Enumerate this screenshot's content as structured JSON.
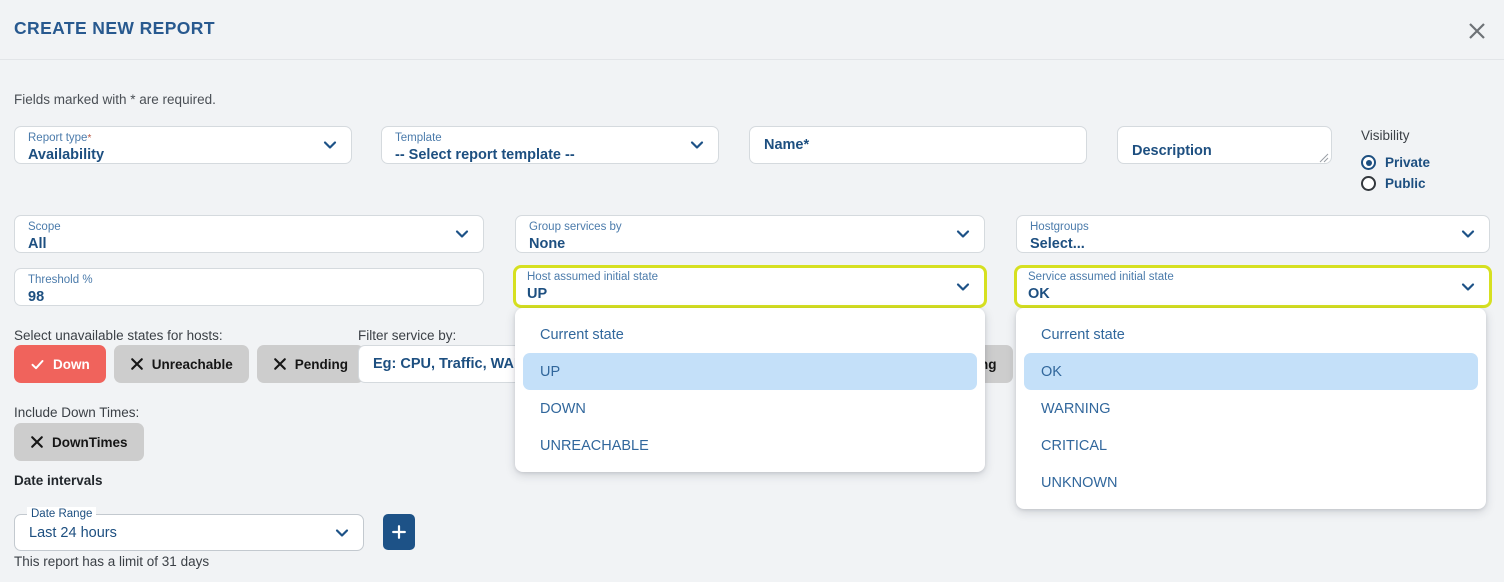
{
  "header": {
    "title": "CREATE NEW REPORT",
    "close_icon": "close-icon"
  },
  "notes": {
    "required": "Fields marked with * are required.",
    "limit": "This report has a limit of 31 days"
  },
  "colors": {
    "accent_navy": "#1d5287",
    "highlight_yellow": "#d6e021",
    "chip_active_red": "#f0635c",
    "chip_inactive_gray": "#cdcdcd",
    "menu_selected_blue": "#c4e0f9"
  },
  "fields": {
    "report_type": {
      "label": "Report type",
      "required_mark": "*",
      "value": "Availability",
      "icon": "chevron-down-icon"
    },
    "template": {
      "label": "Template",
      "value": "-- Select report template --",
      "icon": "chevron-down-icon"
    },
    "name": {
      "placeholder": "Name*",
      "value": ""
    },
    "description": {
      "placeholder": "Description",
      "value": ""
    },
    "scope": {
      "label": "Scope",
      "value": "All",
      "icon": "chevron-down-icon"
    },
    "group_services_by": {
      "label": "Group services by",
      "value": "None",
      "icon": "chevron-down-icon"
    },
    "hostgroups": {
      "label": "Hostgroups",
      "value": "Select...",
      "icon": "chevron-down-icon"
    },
    "threshold": {
      "label": "Threshold %",
      "value": "98"
    },
    "host_initial_state": {
      "label": "Host assumed initial state",
      "value": "UP",
      "icon": "chevron-down-icon",
      "highlighted": true
    },
    "service_initial_state": {
      "label": "Service assumed initial state",
      "value": "OK",
      "icon": "chevron-down-icon",
      "highlighted": true
    },
    "filter_service": {
      "label": "Filter service by:",
      "placeholder": "Eg: CPU, Traffic, WAN"
    },
    "date_range": {
      "label": "Date Range",
      "value": "Last 24 hours",
      "icon": "chevron-down-icon"
    }
  },
  "visibility": {
    "title": "Visibility",
    "options": [
      {
        "label": "Private",
        "selected": true
      },
      {
        "label": "Public",
        "selected": false
      }
    ]
  },
  "host_states": {
    "label": "Select unavailable states for hosts:",
    "chips": [
      {
        "label": "Down",
        "selected": true,
        "icon": "check-icon"
      },
      {
        "label": "Unreachable",
        "selected": false,
        "icon": "x-icon"
      },
      {
        "label": "Pending",
        "selected": false,
        "icon": "x-icon"
      }
    ]
  },
  "service_states": {
    "partial_chip": {
      "label": "Warning",
      "selected": false,
      "icon": "x-icon"
    }
  },
  "downtimes": {
    "label": "Include Down Times:",
    "chip": {
      "label": "DownTimes",
      "selected": false,
      "icon": "x-icon"
    }
  },
  "date_intervals": {
    "heading": "Date intervals",
    "add_button_icon": "plus-icon"
  },
  "host_state_menu": {
    "items": [
      {
        "label": "Current state",
        "selected": false
      },
      {
        "label": "UP",
        "selected": true
      },
      {
        "label": "DOWN",
        "selected": false
      },
      {
        "label": "UNREACHABLE",
        "selected": false
      }
    ]
  },
  "service_state_menu": {
    "items": [
      {
        "label": "Current state",
        "selected": false
      },
      {
        "label": "OK",
        "selected": true
      },
      {
        "label": "WARNING",
        "selected": false
      },
      {
        "label": "CRITICAL",
        "selected": false
      },
      {
        "label": "UNKNOWN",
        "selected": false
      }
    ]
  }
}
